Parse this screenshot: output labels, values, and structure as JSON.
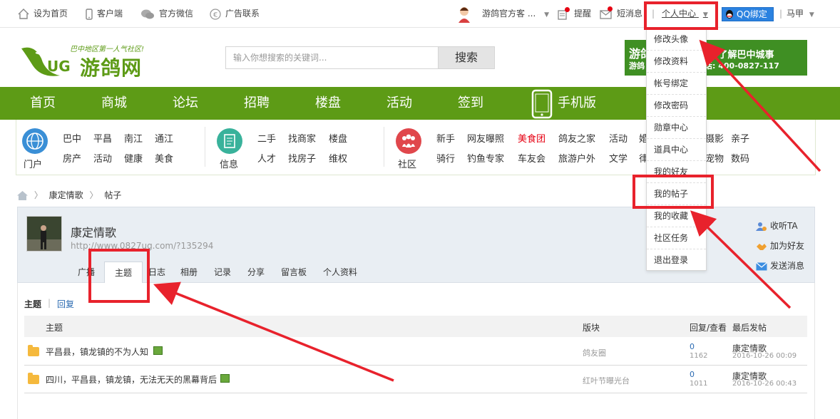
{
  "topbar": {
    "home": "设为首页",
    "client": "客户端",
    "wechat": "官方微信",
    "ads": "广告联系",
    "username": "游鸽官方客 ...",
    "remind": "提醒",
    "message": "短消息",
    "user_center": "个人中心",
    "qq_bind": "QQ绑定",
    "user2": "马甲"
  },
  "logo": {
    "slogan": "巴中地区第一人气社区!",
    "name": "游鸽网",
    "letters": "UG"
  },
  "search": {
    "placeholder": "输入你想搜索的关键词...",
    "button": "搜索"
  },
  "banner": {
    "left": "游鸽",
    "left2": "游鸽",
    "right": "户 了解巴中城事",
    "phone": "话: 400-0827-117"
  },
  "nav": [
    "首页",
    "商城",
    "论坛",
    "招聘",
    "楼盘",
    "活动",
    "签到",
    "手机版"
  ],
  "subnav": {
    "cat1": "门户",
    "cat1_links": [
      "巴中",
      "平昌",
      "南江",
      "通江",
      "房产",
      "活动",
      "健康",
      "美食"
    ],
    "cat2": "信息",
    "cat2_links": [
      "二手",
      "找商家",
      "楼盘",
      "人才",
      "找房子",
      "维权"
    ],
    "cat3": "社区",
    "cat3_links_row1": [
      "新手",
      "网友曝照",
      "美食团",
      "鸽友之家",
      "活动",
      "婚"
    ],
    "cat3_links_row2": [
      "骑行",
      "钓鱼专家",
      "车友会",
      "旅游户外",
      "文学",
      "律"
    ],
    "cat3_extra_row1": [
      "摄影",
      "亲子"
    ],
    "cat3_extra_row2": [
      "宠物",
      "数码"
    ]
  },
  "breadcrumb": {
    "item1": "康定情歌",
    "item2": "帖子"
  },
  "profile": {
    "name": "康定情歌",
    "url": "http://www.0827ug.com/?135294",
    "tabs": [
      "广播",
      "主题",
      "日志",
      "相册",
      "记录",
      "分享",
      "留言板",
      "个人资料"
    ],
    "follow": "收听TA",
    "add_friend": "加为好友",
    "send_msg": "发送消息"
  },
  "content": {
    "tab_topics": "主题",
    "tab_replies": "回复",
    "headers": {
      "topic": "主题",
      "board": "版块",
      "stats": "回复/查看",
      "last": "最后发帖"
    },
    "rows": [
      {
        "title": "平昌县，镇龙镇的不为人知",
        "board": "鸽友圈",
        "replies": "0",
        "views": "1162",
        "last_user": "康定情歌",
        "last_time": "2016-10-26 00:09"
      },
      {
        "title": "四川，平昌县，镇龙镇，无法无天的黑幕背后",
        "board": "红叶节曝光台",
        "replies": "0",
        "views": "1011",
        "last_user": "康定情歌",
        "last_time": "2016-10-26 00:43"
      }
    ]
  },
  "dropdown": [
    "修改头像",
    "修改资料",
    "帐号绑定",
    "修改密码",
    "勋章中心",
    "道具中心",
    "我的好友",
    "我的帖子",
    "我的收藏",
    "社区任务",
    "退出登录"
  ],
  "colors": {
    "nav_green": "#5d9b16",
    "highlight_red": "#e8222c",
    "link_blue": "#2b6bb2"
  }
}
